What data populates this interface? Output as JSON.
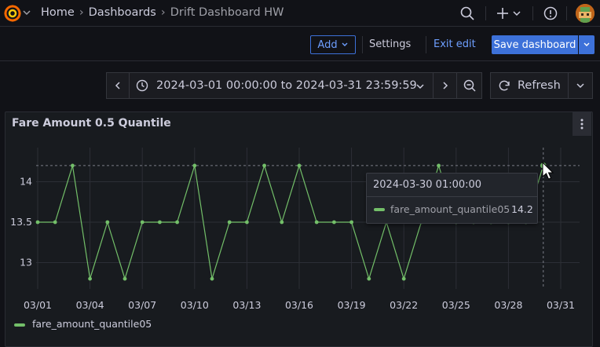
{
  "breadcrumb": {
    "home": "Home",
    "dashboards": "Dashboards",
    "current": "Drift Dashboard HW"
  },
  "toolbar": {
    "add_label": "Add",
    "settings_label": "Settings",
    "exit_edit_label": "Exit edit",
    "save_label": "Save dashboard"
  },
  "time_picker": {
    "range": "2024-03-01 00:00:00 to 2024-03-31 23:59:59"
  },
  "refresh": {
    "label": "Refresh"
  },
  "icons": [
    "grafana-logo-icon",
    "search-icon",
    "plus-icon",
    "help-icon",
    "avatar",
    "clock-icon",
    "zoom-out-icon",
    "refresh-icon",
    "kebab-menu-icon"
  ],
  "colors": {
    "series": "#73bf69",
    "primary": "#3d71d9",
    "link": "#6e9fff"
  },
  "panel": {
    "title": "Fare Amount 0.5 Quantile"
  },
  "tooltip": {
    "time": "2024-03-30 01:00:00",
    "series": "fare_amount_quantile05",
    "value": "14.2"
  },
  "legend": {
    "label": "fare_amount_quantile05"
  },
  "chart_data": {
    "type": "line",
    "title": "Fare Amount 0.5 Quantile",
    "x_tick_labels": [
      "03/01",
      "03/04",
      "03/07",
      "03/10",
      "03/13",
      "03/16",
      "03/19",
      "03/22",
      "03/25",
      "03/28",
      "03/31"
    ],
    "y_tick_labels": [
      "13",
      "13.5",
      "14"
    ],
    "ylim": [
      12.8,
      14.35
    ],
    "xlim": [
      0.5,
      31.2
    ],
    "grid": true,
    "legend_placement": "bottom-left",
    "series": [
      {
        "name": "fare_amount_quantile05",
        "x": [
          1,
          2,
          3,
          4,
          5,
          6,
          7,
          8,
          9,
          10,
          11,
          12,
          13,
          14,
          15,
          16,
          17,
          18,
          19,
          20,
          21,
          22,
          23,
          24,
          25,
          26,
          27,
          28,
          29,
          30
        ],
        "values": [
          13.5,
          13.5,
          14.2,
          12.8,
          13.5,
          12.8,
          13.5,
          13.5,
          13.5,
          14.2,
          12.8,
          13.5,
          13.5,
          14.2,
          13.5,
          14.2,
          13.5,
          13.5,
          13.5,
          12.8,
          13.5,
          12.8,
          13.5,
          14.2,
          13.5,
          13.5,
          13.5,
          13.5,
          13.5,
          14.2
        ]
      }
    ]
  }
}
